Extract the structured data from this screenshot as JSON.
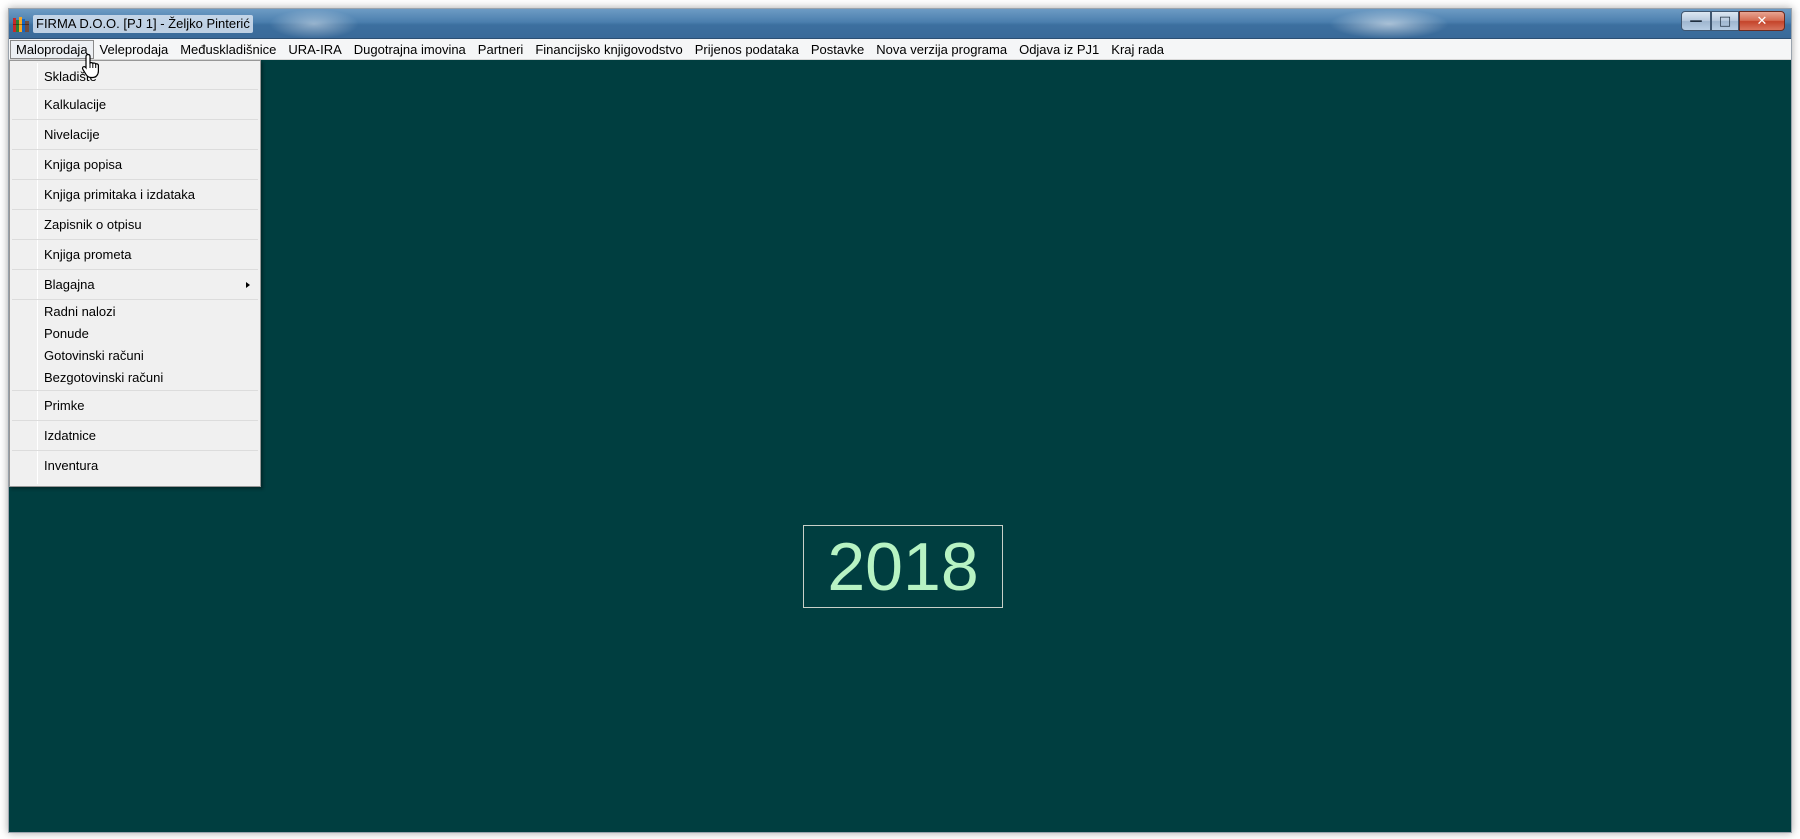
{
  "window": {
    "title": "FIRMA D.O.O. [PJ 1] - Željko Pinterić",
    "controls": {
      "minimize": "—",
      "maximize": "□",
      "close": "✕"
    }
  },
  "menubar": {
    "items": [
      {
        "label": "Maloprodaja",
        "active": true
      },
      {
        "label": "Veleprodaja"
      },
      {
        "label": "Međuskladišnice"
      },
      {
        "label": "URA-IRA"
      },
      {
        "label": "Dugotrajna imovina"
      },
      {
        "label": "Partneri"
      },
      {
        "label": "Financijsko knjigovodstvo"
      },
      {
        "label": "Prijenos podataka"
      },
      {
        "label": "Postavke"
      },
      {
        "label": "Nova verzija programa"
      },
      {
        "label": "Odjava iz PJ1"
      },
      {
        "label": "Kraj rada"
      }
    ]
  },
  "dropdown": {
    "items": [
      {
        "label": "Skladište"
      },
      {
        "label": "Kalkulacije"
      },
      {
        "label": "Nivelacije"
      },
      {
        "label": "Knjiga popisa"
      },
      {
        "label": "Knjiga primitaka i izdataka"
      },
      {
        "label": "Zapisnik o otpisu"
      },
      {
        "label": "Knjiga prometa"
      },
      {
        "label": "Blagajna",
        "has_submenu": true
      },
      {
        "label": "Radni nalozi"
      },
      {
        "label": "Ponude"
      },
      {
        "label": "Gotovinski računi"
      },
      {
        "label": "Bezgotovinski računi"
      },
      {
        "label": "Primke"
      },
      {
        "label": "Izdatnice"
      },
      {
        "label": "Inventura"
      }
    ]
  },
  "main": {
    "year": "2018"
  },
  "colors": {
    "desktop": "#003e40",
    "year_text": "#b7f3c3",
    "menubar": "#f5f6f7",
    "dropdown": "#f0f0f0"
  },
  "icons": {
    "app": "books-icon",
    "cursor": "hand-pointer-icon"
  }
}
